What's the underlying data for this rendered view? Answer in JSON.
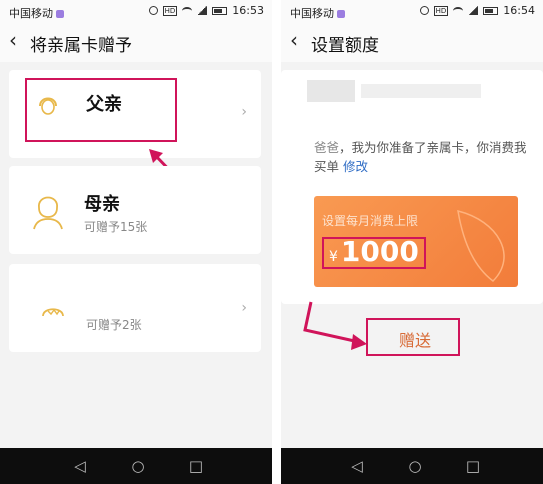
{
  "left": {
    "status": {
      "carrier": "中国移动",
      "time": "16:53"
    },
    "header": {
      "title": "将亲属卡赠予"
    },
    "cards": [
      {
        "name": "父亲",
        "sub": ""
      },
      {
        "name": "母亲",
        "sub": "可赠予15张"
      },
      {
        "name": "",
        "sub": "可赠予2张"
      }
    ]
  },
  "right": {
    "status": {
      "carrier": "中国移动",
      "time": "16:54"
    },
    "header": {
      "title": "设置额度"
    },
    "message": {
      "nickname": "爸爸",
      "text": "，我为你准备了亲属卡，你消费我买单",
      "edit": "修改"
    },
    "limit": {
      "label": "设置每月消费上限",
      "currency": "¥",
      "amount": "1000"
    },
    "gift_button": "赠送"
  },
  "colors": {
    "accent_orange": "#f27c3a",
    "highlight": "#d0145a",
    "link": "#2d6bc4",
    "avatar": "#e8b84a"
  }
}
